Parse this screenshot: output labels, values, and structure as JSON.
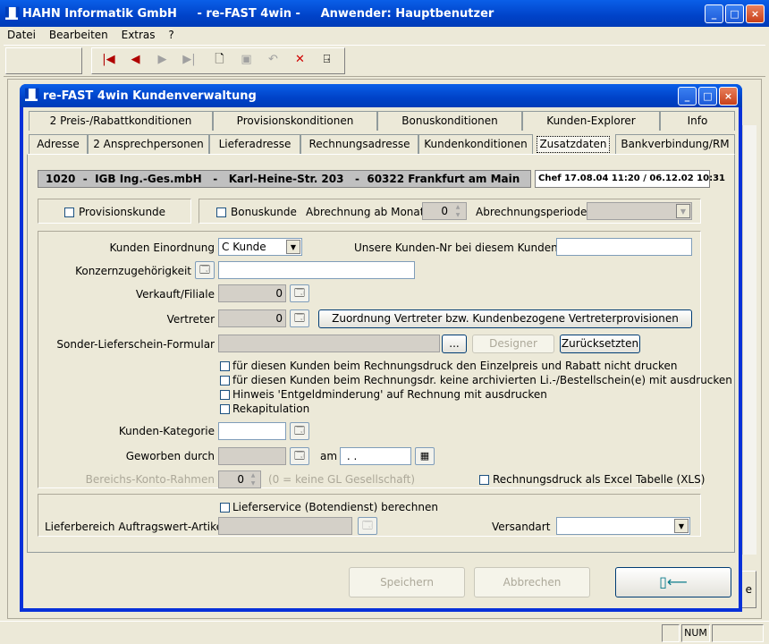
{
  "main_window": {
    "title": "HAHN Informatik GmbH     - re-FAST 4win -     Anwender: Hauptbenutzer",
    "min_label": "_",
    "max_label": "□",
    "close_label": "×"
  },
  "menu": {
    "items": [
      "Datei",
      "Bearbeiten",
      "Extras",
      "?"
    ]
  },
  "toolbar": {
    "icons": [
      "first-record-icon",
      "previous-record-icon",
      "next-record-icon",
      "last-record-icon",
      "new-document-icon",
      "save-disk-icon",
      "undo-icon",
      "delete-icon",
      "exit-door-icon"
    ]
  },
  "status": {
    "num": "NUM"
  },
  "bg_edge": {
    "e_label": "e"
  },
  "dialog": {
    "title": "re-FAST 4win Kundenverwaltung",
    "tabs_row1": [
      "2 Preis-/Rabattkonditionen",
      "Provisionskonditionen",
      "Bonuskonditionen",
      "Kunden-Explorer",
      "Info"
    ],
    "tabs_row2": [
      "Adresse",
      "2 Ansprechpersonen",
      "Lieferadresse",
      "Rechnungsadresse",
      "Kundenkonditionen",
      "Zusatzdaten",
      "Bankverbindung/RM"
    ],
    "header_info": "1020  -  IGB Ing.-Ges.mbH   -   Karl-Heine-Str. 203   -  60322 Frankfurt am Main",
    "header_chef": "Chef 17.08.04 11:20 / 06.12.02 10:31",
    "provisionskunde": "Provisionskunde",
    "bonuskunde": "Bonuskunde",
    "abrechnung_ab_monat": "Abrechnung ab Monat",
    "abrechnung_ab_monat_value": "0",
    "abrechnungsperiode": "Abrechnungsperiode",
    "kunden_einordnung": "Kunden Einordnung",
    "kunden_einordnung_value": "C Kunde",
    "unsere_kunden_nr": "Unsere Kunden-Nr bei diesem Kunden",
    "konzern": "Konzernzugehörigkeit",
    "verkauf_filiale": "Verkauft/Filiale",
    "verkauf_filiale_value": "0",
    "vertreter": "Vertreter",
    "vertreter_value": "0",
    "zuordnung_button": "Zuordnung Vertreter bzw. Kundenbezogene Vertreterprovisionen",
    "sonder_formular": "Sonder-Lieferschein-Formular",
    "ellipsis": "...",
    "designer": "Designer",
    "zuruecksetzen": "Zurücksetzten",
    "cb1": "für diesen Kunden beim Rechnungsdruck den Einzelpreis und Rabatt nicht drucken",
    "cb2": "für diesen Kunden beim Rechnungsdr. keine archivierten Li.-/Bestellschein(e) mit ausdrucken",
    "cb3": "Hinweis 'Entgeldminderung' auf Rechnung mit ausdrucken",
    "cb4": "Rekapitulation",
    "kunden_kategorie": "Kunden-Kategorie",
    "geworben_durch": "Geworben durch",
    "am": "am",
    "am_value": " . .",
    "bereichs_konto": "Bereichs-Konto-Rahmen",
    "bereichs_konto_value": "0",
    "bereichs_hint": "(0 = keine GL Gesellschaft)",
    "xls": "Rechnungsdruck als Excel Tabelle (XLS)",
    "lieferservice": "Lieferservice (Botendienst) berechnen",
    "lieferbereich": "Lieferbereich Auftragswert-Artikel",
    "versandart": "Versandart",
    "speichern": "Speichern",
    "abbrechen": "Abbrechen"
  }
}
